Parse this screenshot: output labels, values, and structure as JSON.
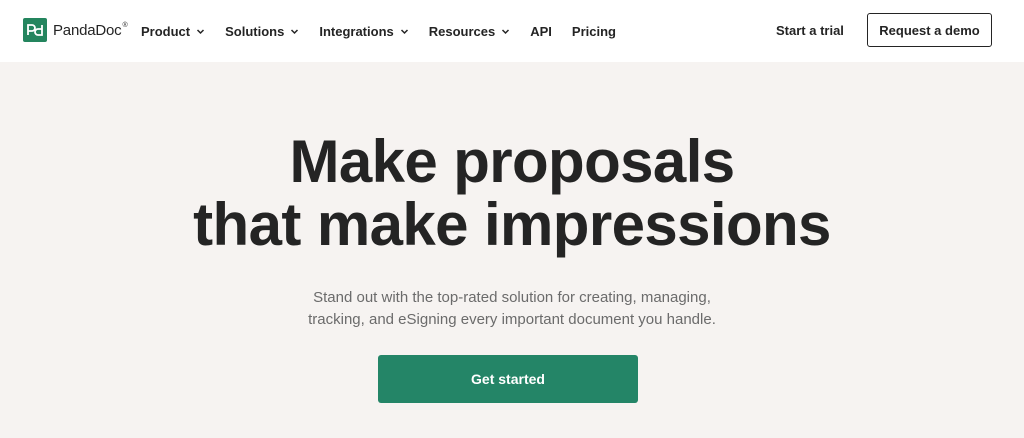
{
  "header": {
    "logo": {
      "icon": "pandadoc-logo-icon",
      "text": "PandaDoc",
      "trademark": "®",
      "brand_color": "#24855e"
    },
    "nav": [
      {
        "label": "Product",
        "has_dropdown": true
      },
      {
        "label": "Solutions",
        "has_dropdown": true
      },
      {
        "label": "Integrations",
        "has_dropdown": true
      },
      {
        "label": "Resources",
        "has_dropdown": true
      },
      {
        "label": "API",
        "has_dropdown": false
      },
      {
        "label": "Pricing",
        "has_dropdown": false
      }
    ],
    "start_trial_label": "Start a trial",
    "request_demo_label": "Request a demo"
  },
  "hero": {
    "headline_line1": "Make proposals",
    "headline_line2": "that make impressions",
    "subtitle_line1": "Stand out with the top-rated solution for creating, managing,",
    "subtitle_line2": "tracking, and eSigning every important document you handle.",
    "cta_label": "Get started",
    "cta_color": "#248567",
    "background_color": "#f6f3f1"
  }
}
